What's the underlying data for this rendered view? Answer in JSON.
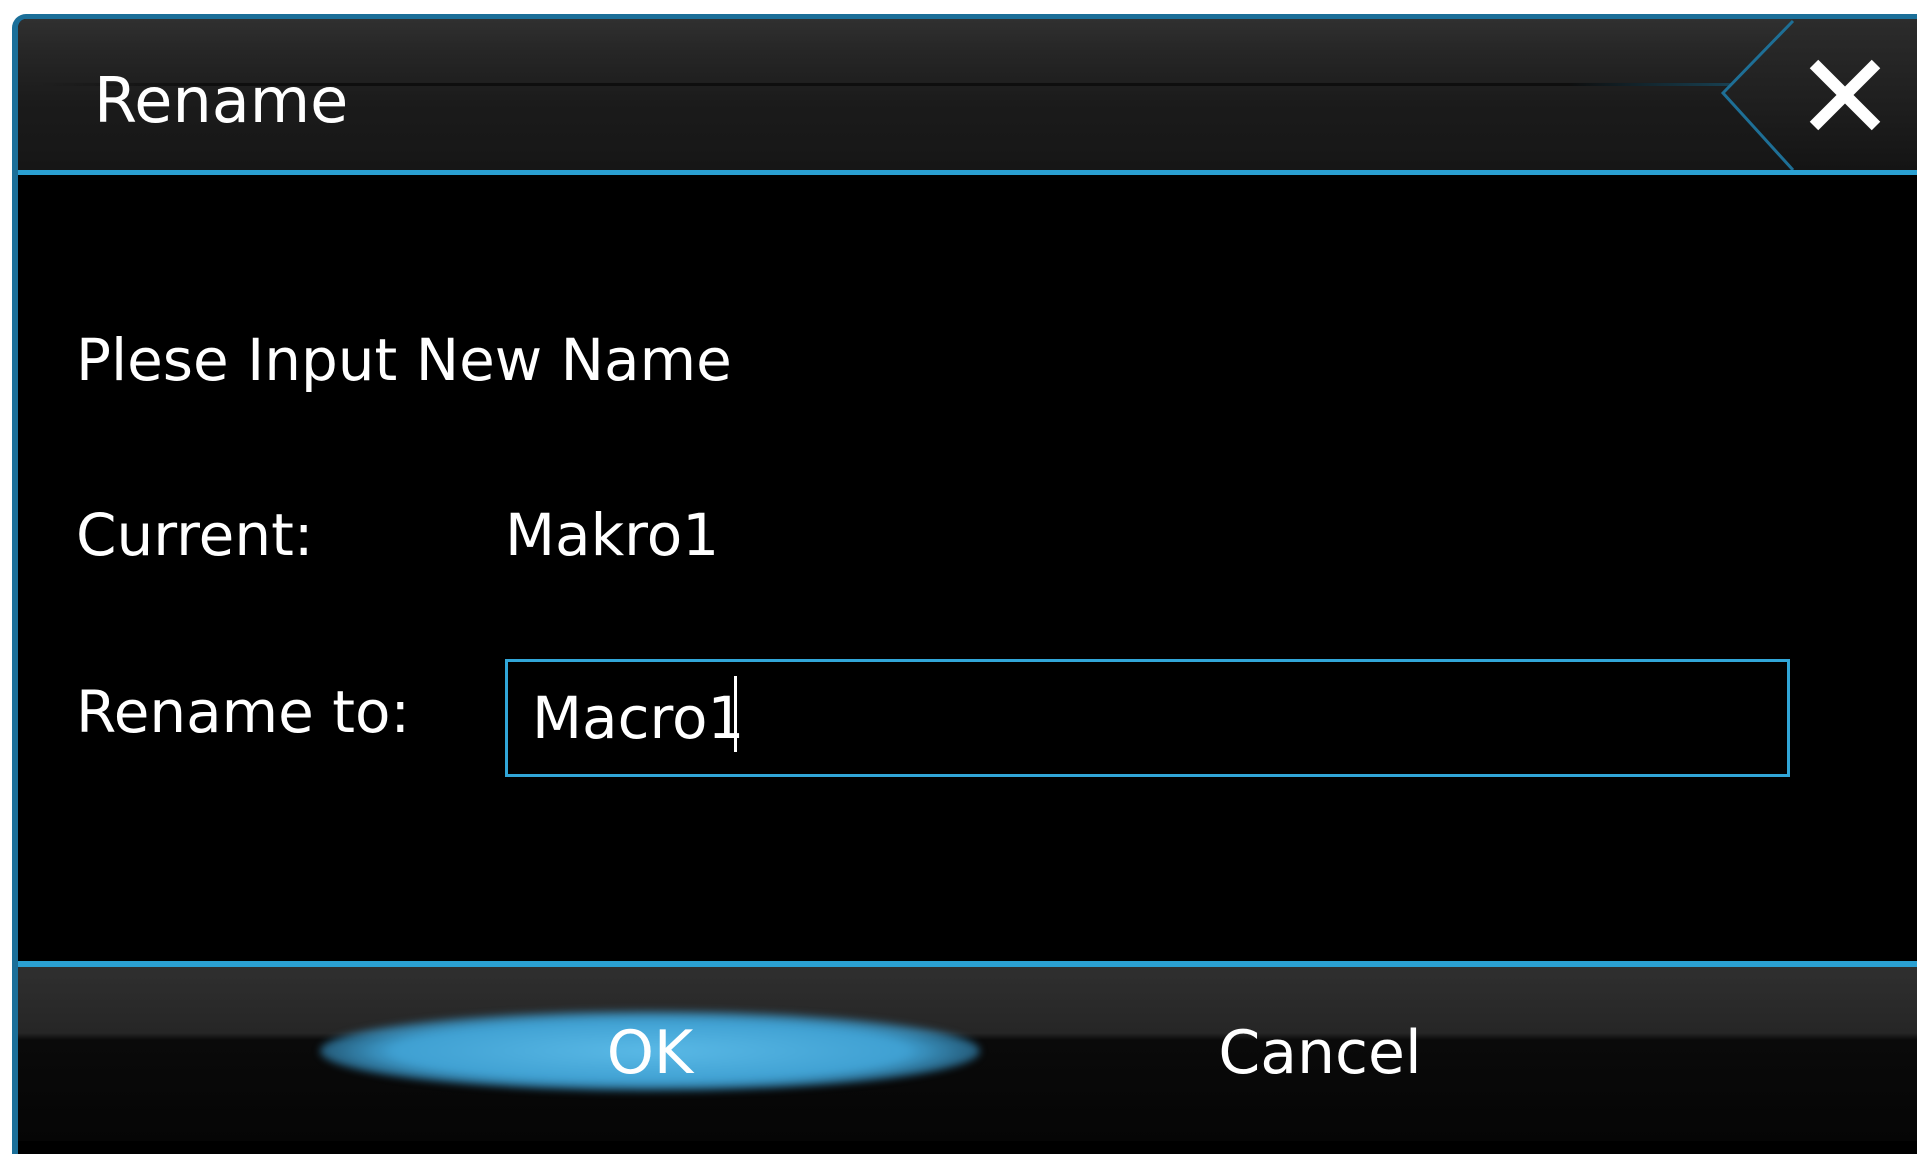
{
  "window": {
    "title": "Rename",
    "close_icon": "close-icon"
  },
  "form": {
    "prompt": "Plese Input New Name",
    "current_label": "Current:",
    "current_value": "Makro1",
    "rename_label": "Rename to:",
    "rename_value": "Macro1"
  },
  "buttons": {
    "ok": "OK",
    "cancel": "Cancel"
  },
  "colors": {
    "accent": "#2aa0d2",
    "background": "#000000",
    "text": "#ffffff",
    "ok_highlight": "#4aaee0"
  }
}
